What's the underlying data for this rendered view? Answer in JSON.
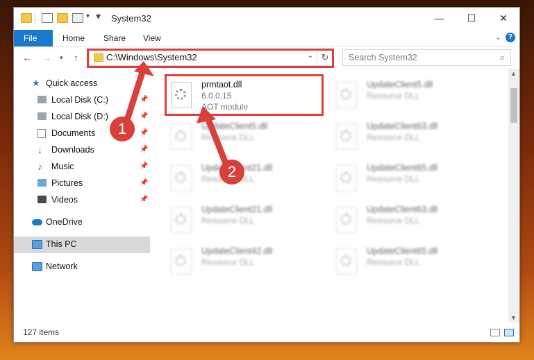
{
  "window": {
    "title": "System32",
    "controls": [
      "minimize-icon",
      "maximize-icon",
      "close-icon"
    ]
  },
  "ribbon": {
    "tabs": [
      "File",
      "Home",
      "Share",
      "View"
    ],
    "help": "?"
  },
  "navigation": {
    "address": "C:\\Windows\\System32",
    "search_placeholder": "Search System32"
  },
  "sidebar": {
    "items": [
      {
        "label": "Quick access",
        "icon": "star-icon",
        "pinned": false
      },
      {
        "label": "Local Disk (C:)",
        "icon": "drive-icon",
        "pinned": true
      },
      {
        "label": "Local Disk (D:)",
        "icon": "drive-icon",
        "pinned": true
      },
      {
        "label": "Documents",
        "icon": "documents-icon",
        "pinned": true
      },
      {
        "label": "Downloads",
        "icon": "download-icon",
        "pinned": true
      },
      {
        "label": "Music",
        "icon": "music-icon",
        "pinned": true
      },
      {
        "label": "Pictures",
        "icon": "pictures-icon",
        "pinned": true
      },
      {
        "label": "Videos",
        "icon": "videos-icon",
        "pinned": true
      },
      {
        "label": "OneDrive",
        "icon": "cloud-icon",
        "pinned": false
      },
      {
        "label": "This PC",
        "icon": "computer-icon",
        "pinned": false,
        "selected": true
      },
      {
        "label": "Network",
        "icon": "network-icon",
        "pinned": false
      }
    ]
  },
  "files": [
    {
      "name": "prmtaot.dll",
      "version": "6.0.0.15",
      "description": "AOT module",
      "highlighted": true
    },
    {
      "name": "UpdateClient5.dll",
      "description": "Resource DLL"
    },
    {
      "name": "UpdateClient5.dll",
      "description": "Resource DLL"
    },
    {
      "name": "UpdateClient63.dll",
      "description": "Resource DLL"
    },
    {
      "name": "UpdateClient21.dll",
      "description": "Resource DLL"
    },
    {
      "name": "UpdateClient65.dll",
      "description": "Resource DLL"
    },
    {
      "name": "UpdateClient21.dll",
      "description": "Resource DLL"
    },
    {
      "name": "UpdateClient63.dll",
      "description": "Resource DLL"
    },
    {
      "name": "UpdateClient42.dll",
      "description": "Resource DLL"
    },
    {
      "name": "UpdateClient65.dll",
      "description": "Resource DLL"
    }
  ],
  "status": {
    "item_count": "127 items"
  },
  "annotations": {
    "marker_1": "1",
    "marker_2": "2",
    "color": "#d9403a"
  }
}
